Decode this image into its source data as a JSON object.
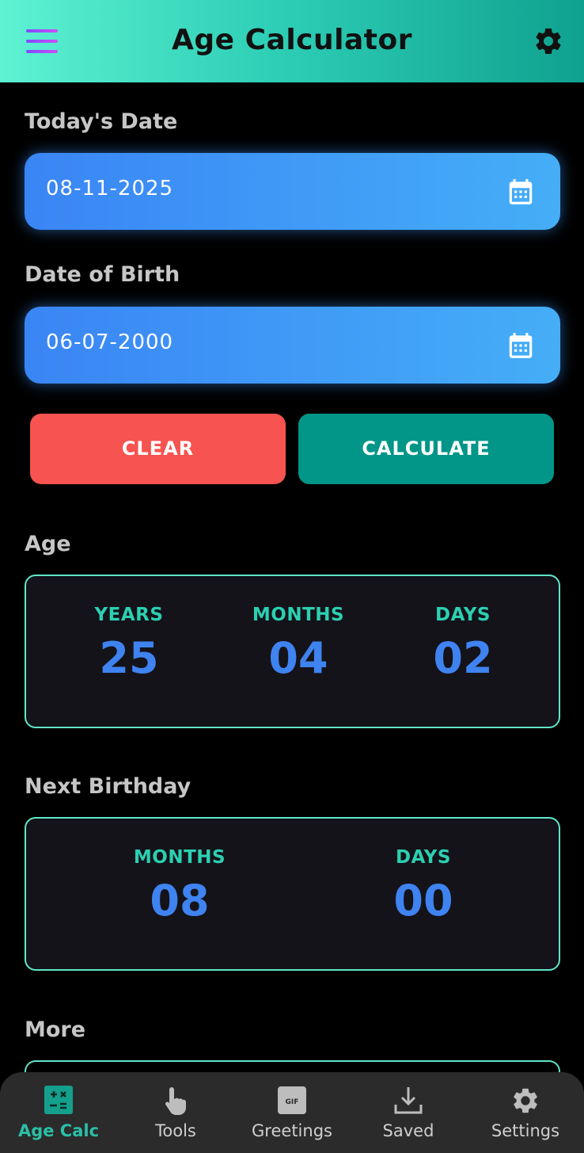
{
  "app": {
    "title": "Age Calculator"
  },
  "icons": {
    "menu": "menu-icon",
    "settings": "gear-icon",
    "calendar": "calendar-icon"
  },
  "colors": {
    "accent": "#2bd0b1",
    "clear": "#f75350",
    "calculate": "#029688",
    "value": "#3f83f0"
  },
  "today": {
    "label": "Today's Date",
    "value": "08-11-2025"
  },
  "birth": {
    "label": "Date of Birth",
    "value": "06-07-2000"
  },
  "buttons": {
    "clear": "CLEAR",
    "calculate": "CALCULATE"
  },
  "age": {
    "label": "Age",
    "years_label": "YEARS",
    "years": "25",
    "months_label": "MONTHS",
    "months": "04",
    "days_label": "DAYS",
    "days": "02"
  },
  "next_birthday": {
    "label": "Next Birthday",
    "months_label": "MONTHS",
    "months": "08",
    "days_label": "DAYS",
    "days": "00"
  },
  "more": {
    "label": "More"
  },
  "nav": [
    {
      "label": "Age Calc",
      "icon": "calculator-icon",
      "active": true
    },
    {
      "label": "Tools",
      "icon": "hand-pointer-icon",
      "active": false
    },
    {
      "label": "Greetings",
      "icon": "gif-icon",
      "active": false
    },
    {
      "label": "Saved",
      "icon": "download-icon",
      "active": false
    },
    {
      "label": "Settings",
      "icon": "gear-icon",
      "active": false
    }
  ]
}
